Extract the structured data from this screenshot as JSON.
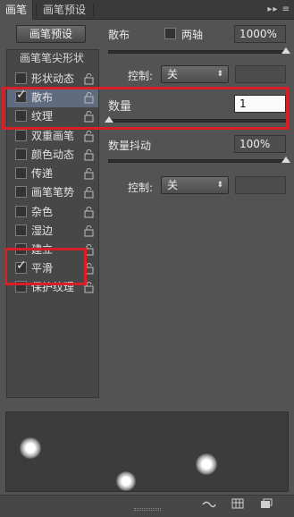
{
  "tabs": [
    {
      "label": "画笔",
      "active": true
    },
    {
      "label": "画笔预设",
      "active": false
    }
  ],
  "left": {
    "preset_button": "画笔预设",
    "list_header": "画笔笔尖形状",
    "items": [
      {
        "label": "形状动态",
        "checked": false
      },
      {
        "label": "散布",
        "checked": true,
        "selected": true
      },
      {
        "label": "纹理",
        "checked": false
      },
      {
        "label": "双重画笔",
        "checked": false
      },
      {
        "label": "颜色动态",
        "checked": false
      },
      {
        "label": "传递",
        "checked": false
      },
      {
        "label": "画笔笔势",
        "checked": false
      },
      {
        "label": "杂色",
        "checked": false
      },
      {
        "label": "湿边",
        "checked": false
      },
      {
        "label": "建立",
        "checked": false
      },
      {
        "label": "平滑",
        "checked": true
      },
      {
        "label": "保护纹理",
        "checked": false
      }
    ]
  },
  "right": {
    "scatter_label": "散布",
    "both_axes_label": "两轴",
    "scatter_value": "1000%",
    "scatter_level": 1.0,
    "control_label_1": "控制:",
    "control_value_1": "关",
    "count_label": "数量",
    "count_value": "1",
    "count_level": 0.0,
    "count_jitter_label": "数量抖动",
    "count_jitter_value": "100%",
    "count_jitter_level": 1.0,
    "control_label_2": "控制:",
    "control_value_2": "关"
  },
  "colors": {
    "panel_bg": "#535353",
    "selected_item": "#5f6c80",
    "annotation_red": "#d61f26"
  },
  "icons": {
    "tab_menu": "double-chevron-menu-icon",
    "lock": "lock-icon",
    "bottom": [
      "toggle-brush-icon",
      "grid-icon",
      "new-brush-icon"
    ]
  }
}
